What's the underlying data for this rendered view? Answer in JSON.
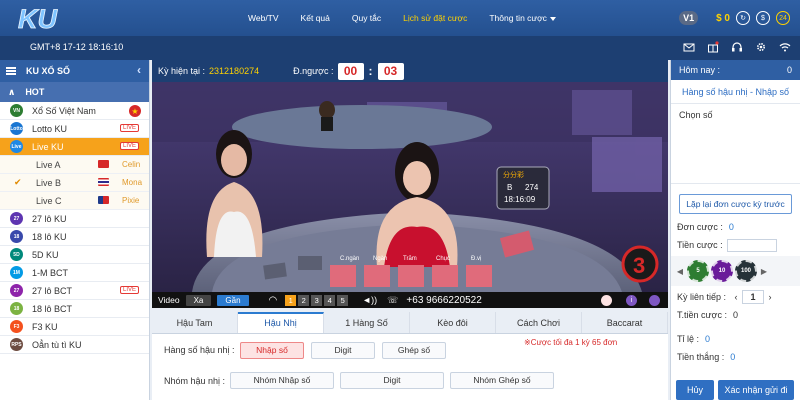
{
  "header": {
    "logo_text": "KU",
    "nav": [
      {
        "label": "Web/TV",
        "active": false
      },
      {
        "label": "Kết quả",
        "active": false
      },
      {
        "label": "Quy tắc",
        "active": false
      },
      {
        "label": "Lịch sử đặt cược",
        "active": true
      },
      {
        "label": "Thông tin cược",
        "active": false
      }
    ],
    "vip": "V1",
    "balance": "$ 0",
    "badge": "24"
  },
  "subheader": {
    "clock": "GMT+8 17-12 18:16:10",
    "icons": [
      "mail-icon",
      "gift-icon",
      "headset-icon",
      "settings-icon",
      "wifi-icon"
    ]
  },
  "sidebar": {
    "title": "KU XỔ SỐ",
    "hot_label": "HOT",
    "items": [
      {
        "label": "Xổ Số Việt Nam",
        "color": "#2e7d32",
        "glyph": "VN",
        "tag": "star"
      },
      {
        "label": "Lotto KU",
        "color": "#1976d2",
        "glyph": "Lotto",
        "tag": "live"
      },
      {
        "label": "Live KU",
        "color": "#1e88e5",
        "glyph": "Live",
        "tag": "live",
        "active": true
      }
    ],
    "live_rooms": [
      {
        "label": "Live A",
        "dealer": "Celin",
        "flag": "vn",
        "checked": false
      },
      {
        "label": "Live B",
        "dealer": "Mona",
        "flag": "th",
        "checked": true
      },
      {
        "label": "Live C",
        "dealer": "Pixie",
        "flag": "tw",
        "checked": false
      }
    ],
    "games": [
      {
        "label": "27 lô KU",
        "color": "#5e35b1",
        "glyph": "27",
        "tag": ""
      },
      {
        "label": "18 lô KU",
        "color": "#3949ab",
        "glyph": "18",
        "tag": ""
      },
      {
        "label": "5D KU",
        "color": "#00897b",
        "glyph": "5D",
        "tag": ""
      },
      {
        "label": "1-M BCT",
        "color": "#039be5",
        "glyph": "1M",
        "tag": ""
      },
      {
        "label": "27 lô BCT",
        "color": "#8e24aa",
        "glyph": "27",
        "tag": "live"
      },
      {
        "label": "18 lô BCT",
        "color": "#7cb342",
        "glyph": "18",
        "tag": ""
      },
      {
        "label": "F3 KU",
        "color": "#f4511e",
        "glyph": "F3",
        "tag": ""
      },
      {
        "label": "Oẳn tù tì KU",
        "color": "#6d4c41",
        "glyph": "RPS",
        "tag": ""
      }
    ],
    "live_tag_text": "LIVE"
  },
  "period": {
    "label": "Kỳ hiện tại :",
    "number": "2312180274",
    "countdown_label": "Đ.ngược :",
    "minutes": "00",
    "seconds": "03"
  },
  "video": {
    "scoreboard_title": "分分彩",
    "scoreboard_room": "B",
    "scoreboard_num": "274",
    "scoreboard_time": "18:16:09",
    "countdown_big": "3",
    "table_labels": [
      "C.ngàn",
      "Ngàn",
      "Trăm",
      "Chục",
      "Đ.vị"
    ]
  },
  "video_bar": {
    "label": "Video",
    "btn_a": "Xa",
    "btn_b": "Gần",
    "cams": [
      "1",
      "2",
      "3",
      "4",
      "5"
    ],
    "phone": "+63 9666220522"
  },
  "tabs": [
    "Hậu Tam",
    "Hậu Nhị",
    "1 Hàng Số",
    "Kèo đôi",
    "Cách Chơi",
    "Baccarat"
  ],
  "betpanel": {
    "row1_label": "Hàng số hậu nhị :",
    "row1_btns": [
      "Nhập số",
      "Digit",
      "Ghép số"
    ],
    "note": "※Cược tối đa 1 kỳ 65 đơn",
    "row2_label": "Nhóm hậu nhị :",
    "row2_btns": [
      "Nhóm Nhập số",
      "Digit",
      "Nhóm Ghép số"
    ]
  },
  "rpanel": {
    "today_label": "Hôm nay :",
    "today_value": "0",
    "bet_type": "Hàng số hậu nhị - Nhập số",
    "choose_label": "Chọn số",
    "repeat_btn": "Lặp lại đơn cược kỳ trước",
    "orders_label": "Đơn cược :",
    "orders_value": "0",
    "amount_label": "Tiền cược :",
    "amount_value": "",
    "chips": [
      {
        "value": "5",
        "color": "#2e7d32"
      },
      {
        "value": "10",
        "color": "#6a1b9a"
      },
      {
        "value": "100",
        "color": "#263238"
      }
    ],
    "periods_label": "Kỳ liên tiếp :",
    "periods_value": "1",
    "total_label": "T.tiền cược :",
    "total_value": "0",
    "rate_label": "Tỉ lệ :",
    "rate_value": "0",
    "win_label": "Tiền thắng :",
    "win_value": "0",
    "cancel_btn": "Hủy",
    "confirm_btn": "Xác nhận gửi đi"
  }
}
